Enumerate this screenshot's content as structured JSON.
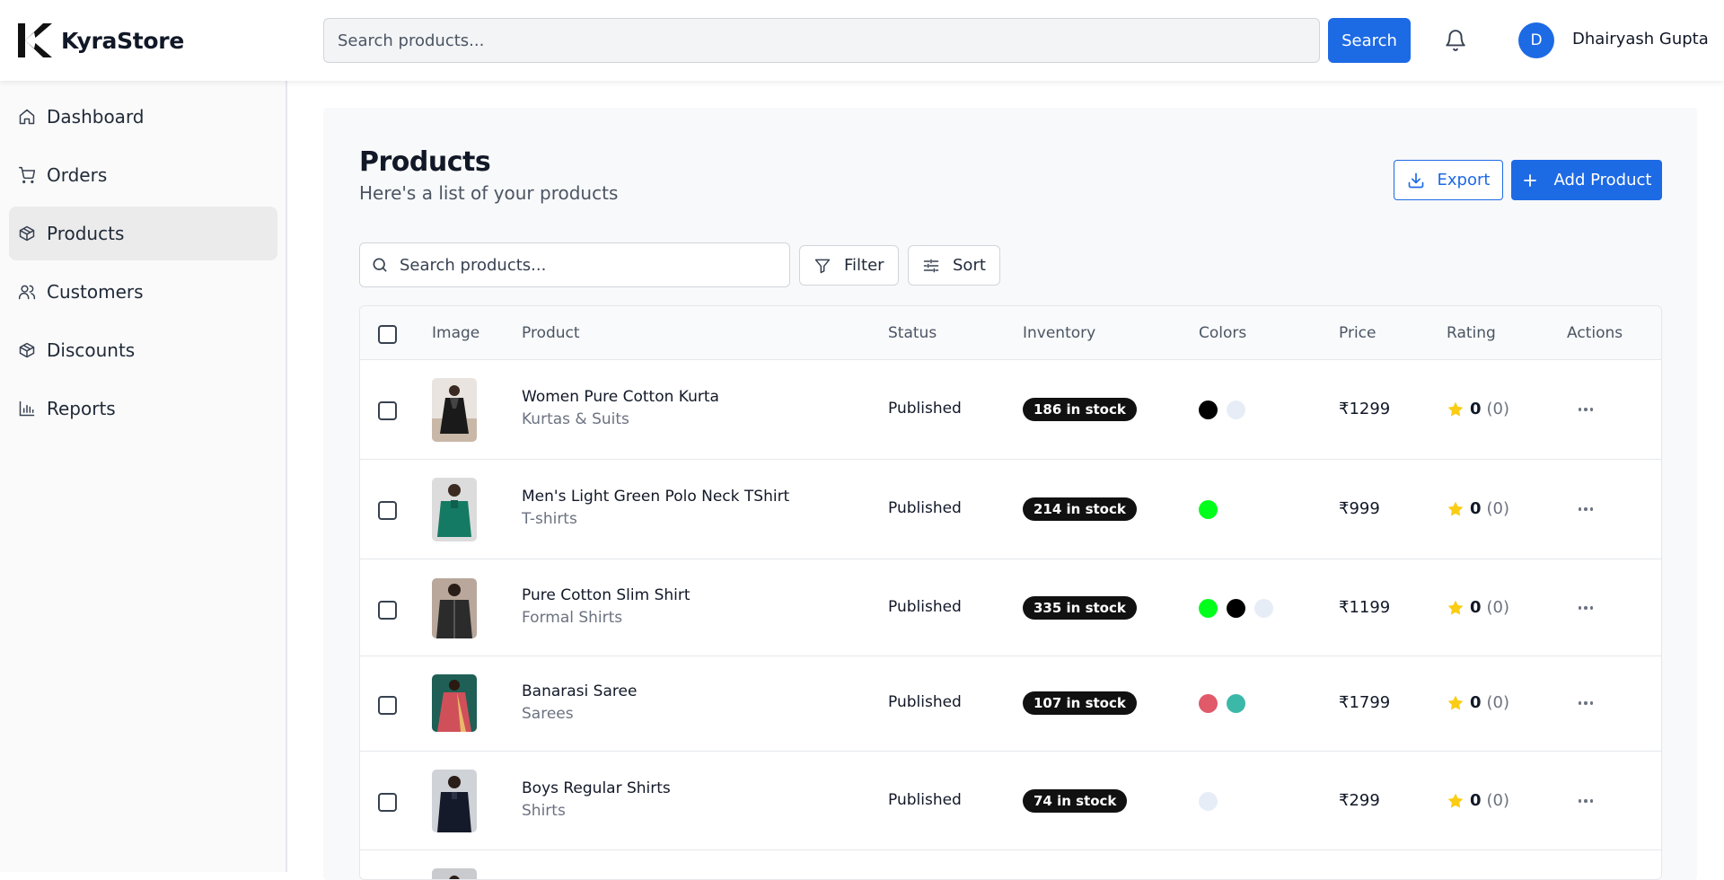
{
  "app": {
    "name": "KyraStore"
  },
  "header": {
    "search_placeholder": "Search products...",
    "search_button": "Search",
    "user": {
      "initial": "D",
      "name": "Dhairyash Gupta"
    }
  },
  "sidebar": {
    "items": [
      {
        "label": "Dashboard",
        "icon": "home-icon"
      },
      {
        "label": "Orders",
        "icon": "cart-icon"
      },
      {
        "label": "Products",
        "icon": "box-icon",
        "active": true
      },
      {
        "label": "Customers",
        "icon": "users-icon"
      },
      {
        "label": "Discounts",
        "icon": "box-icon"
      },
      {
        "label": "Reports",
        "icon": "chart-icon"
      }
    ]
  },
  "page": {
    "title": "Products",
    "subtitle": "Here's a list of your products",
    "export_label": "Export",
    "add_label": "Add Product",
    "search_placeholder": "Search products...",
    "filter_label": "Filter",
    "sort_label": "Sort"
  },
  "table": {
    "columns": [
      "Image",
      "Product",
      "Status",
      "Inventory",
      "Colors",
      "Price",
      "Rating",
      "Actions"
    ],
    "rows": [
      {
        "name": "Women Pure Cotton Kurta",
        "category": "Kurtas & Suits",
        "status": "Published",
        "stock": "186 in stock",
        "colors": [
          "#000000",
          "#e6edf7"
        ],
        "price": "₹1299",
        "rating": "0",
        "rating_count": "(0)"
      },
      {
        "name": "Men's Light Green Polo Neck TShirt",
        "category": "T-shirts",
        "status": "Published",
        "stock": "214 in stock",
        "colors": [
          "#00ff1a"
        ],
        "price": "₹999",
        "rating": "0",
        "rating_count": "(0)"
      },
      {
        "name": "Pure Cotton Slim Shirt",
        "category": "Formal Shirts",
        "status": "Published",
        "stock": "335 in stock",
        "colors": [
          "#00ff1a",
          "#000000",
          "#e6edf7"
        ],
        "price": "₹1199",
        "rating": "0",
        "rating_count": "(0)"
      },
      {
        "name": "Banarasi Saree",
        "category": "Sarees",
        "status": "Published",
        "stock": "107 in stock",
        "colors": [
          "#e05a6a",
          "#3bb8a8"
        ],
        "price": "₹1799",
        "rating": "0",
        "rating_count": "(0)"
      },
      {
        "name": "Boys Regular Shirts",
        "category": "Shirts",
        "status": "Published",
        "stock": "74 in stock",
        "colors": [
          "#e6edf7"
        ],
        "price": "₹299",
        "rating": "0",
        "rating_count": "(0)"
      }
    ]
  },
  "colors": {
    "accent": "#1d6ae5",
    "star": "#facc15"
  }
}
